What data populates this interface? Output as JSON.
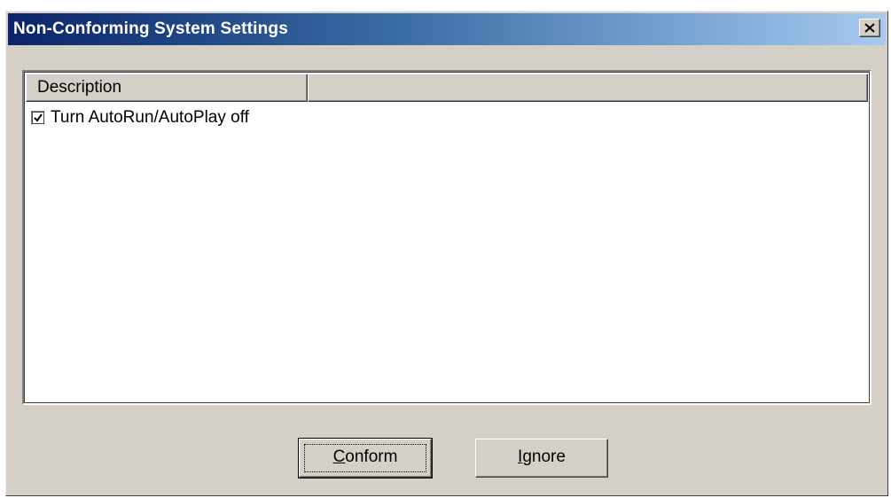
{
  "window": {
    "title": "Non-Conforming System Settings",
    "close_icon": "close-icon",
    "colors": {
      "titlebar_start": "#0a246a",
      "titlebar_end": "#a6caf0",
      "face": "#d4d0c8"
    }
  },
  "list": {
    "columns": [
      "Description",
      ""
    ],
    "rows": [
      {
        "checked": true,
        "label": "Turn AutoRun/AutoPlay off"
      }
    ]
  },
  "buttons": {
    "conform": {
      "mnemonic": "C",
      "rest": "onform"
    },
    "ignore": {
      "mnemonic": "I",
      "rest": "gnore"
    }
  }
}
